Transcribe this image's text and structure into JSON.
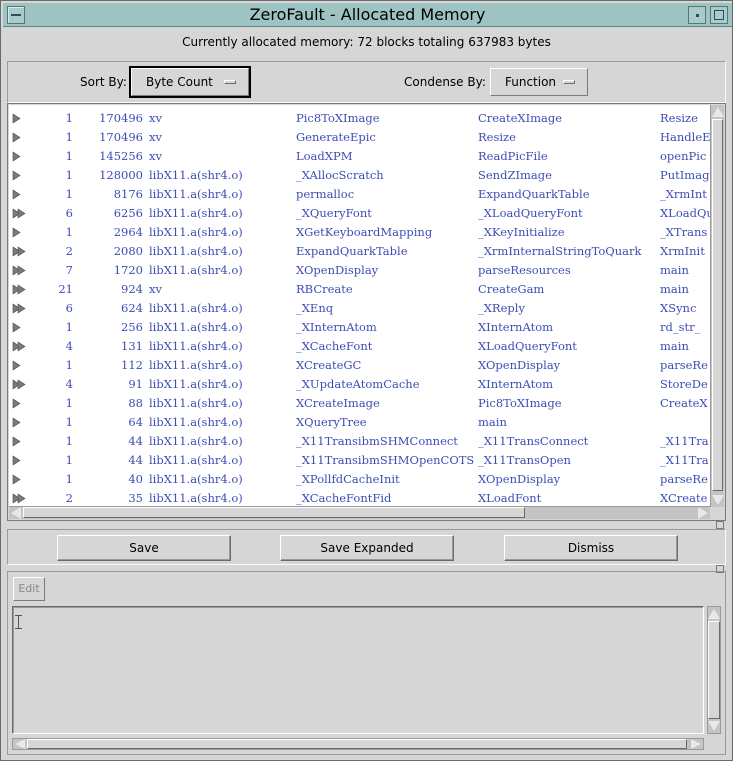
{
  "window": {
    "title": "ZeroFault - Allocated Memory"
  },
  "summary": "Currently allocated memory: 72 blocks totaling 637983 bytes",
  "sort": {
    "label": "Sort By:",
    "value": "Byte Count"
  },
  "condense": {
    "label": "Condense By:",
    "value": "Function"
  },
  "rows": [
    {
      "arrow": "single",
      "count": "1",
      "bytes": "170496",
      "module": "xv",
      "f1": "Pic8ToXImage",
      "f2": "CreateXImage",
      "f3": "Resize"
    },
    {
      "arrow": "single",
      "count": "1",
      "bytes": "170496",
      "module": "xv",
      "f1": "GenerateEpic",
      "f2": "Resize",
      "f3": "HandleE"
    },
    {
      "arrow": "single",
      "count": "1",
      "bytes": "145256",
      "module": "xv",
      "f1": "LoadXPM",
      "f2": "ReadPicFile",
      "f3": "openPic"
    },
    {
      "arrow": "single",
      "count": "1",
      "bytes": "128000",
      "module": "libX11.a(shr4.o)",
      "f1": "_XAllocScratch",
      "f2": "SendZImage",
      "f3": "PutImag"
    },
    {
      "arrow": "single",
      "count": "1",
      "bytes": "8176",
      "module": "libX11.a(shr4.o)",
      "f1": "permalloc",
      "f2": "ExpandQuarkTable",
      "f3": "_XrmInt"
    },
    {
      "arrow": "double",
      "count": "6",
      "bytes": "6256",
      "module": "libX11.a(shr4.o)",
      "f1": "_XQueryFont",
      "f2": "_XLoadQueryFont",
      "f3": "XLoadQu"
    },
    {
      "arrow": "single",
      "count": "1",
      "bytes": "2964",
      "module": "libX11.a(shr4.o)",
      "f1": "XGetKeyboardMapping",
      "f2": "_XKeyInitialize",
      "f3": "_XTrans"
    },
    {
      "arrow": "double",
      "count": "2",
      "bytes": "2080",
      "module": "libX11.a(shr4.o)",
      "f1": "ExpandQuarkTable",
      "f2": "_XrmInternalStringToQuark",
      "f3": "XrmInit"
    },
    {
      "arrow": "double",
      "count": "7",
      "bytes": "1720",
      "module": "libX11.a(shr4.o)",
      "f1": "XOpenDisplay",
      "f2": "parseResources",
      "f3": "main"
    },
    {
      "arrow": "double",
      "count": "21",
      "bytes": "924",
      "module": "xv",
      "f1": "RBCreate",
      "f2": "CreateGam",
      "f3": "main"
    },
    {
      "arrow": "double",
      "count": "6",
      "bytes": "624",
      "module": "libX11.a(shr4.o)",
      "f1": "_XEnq",
      "f2": "_XReply",
      "f3": "XSync"
    },
    {
      "arrow": "single",
      "count": "1",
      "bytes": "256",
      "module": "libX11.a(shr4.o)",
      "f1": "_XInternAtom",
      "f2": "XInternAtom",
      "f3": "rd_str_"
    },
    {
      "arrow": "double",
      "count": "4",
      "bytes": "131",
      "module": "libX11.a(shr4.o)",
      "f1": "_XCacheFont",
      "f2": "XLoadQueryFont",
      "f3": "main"
    },
    {
      "arrow": "single",
      "count": "1",
      "bytes": "112",
      "module": "libX11.a(shr4.o)",
      "f1": "XCreateGC",
      "f2": "XOpenDisplay",
      "f3": "parseRe"
    },
    {
      "arrow": "double",
      "count": "4",
      "bytes": "91",
      "module": "libX11.a(shr4.o)",
      "f1": "_XUpdateAtomCache",
      "f2": "XInternAtom",
      "f3": "StoreDe"
    },
    {
      "arrow": "single",
      "count": "1",
      "bytes": "88",
      "module": "libX11.a(shr4.o)",
      "f1": "XCreateImage",
      "f2": "Pic8ToXImage",
      "f3": "CreateX"
    },
    {
      "arrow": "single",
      "count": "1",
      "bytes": "64",
      "module": "libX11.a(shr4.o)",
      "f1": "XQueryTree",
      "f2": "main",
      "f3": ""
    },
    {
      "arrow": "single",
      "count": "1",
      "bytes": "44",
      "module": "libX11.a(shr4.o)",
      "f1": "_X11TransibmSHMConnect",
      "f2": "_X11TransConnect",
      "f3": "_X11Tra"
    },
    {
      "arrow": "single",
      "count": "1",
      "bytes": "44",
      "module": "libX11.a(shr4.o)",
      "f1": "_X11TransibmSHMOpenCOTS",
      "f2": "_X11TransOpen",
      "f3": "_X11Tra"
    },
    {
      "arrow": "single",
      "count": "1",
      "bytes": "40",
      "module": "libX11.a(shr4.o)",
      "f1": "_XPollfdCacheInit",
      "f2": "XOpenDisplay",
      "f3": "parseRe"
    },
    {
      "arrow": "double",
      "count": "2",
      "bytes": "35",
      "module": "libX11.a(shr4.o)",
      "f1": "_XCacheFontFid",
      "f2": "XLoadFont",
      "f3": "XCreate"
    }
  ],
  "buttons": {
    "save": "Save",
    "save_expanded": "Save Expanded",
    "dismiss": "Dismiss",
    "edit": "Edit"
  },
  "colors": {
    "list_text": "#3d4db5",
    "titlebar": "#9dc3c3",
    "background": "#d6d6d6"
  }
}
